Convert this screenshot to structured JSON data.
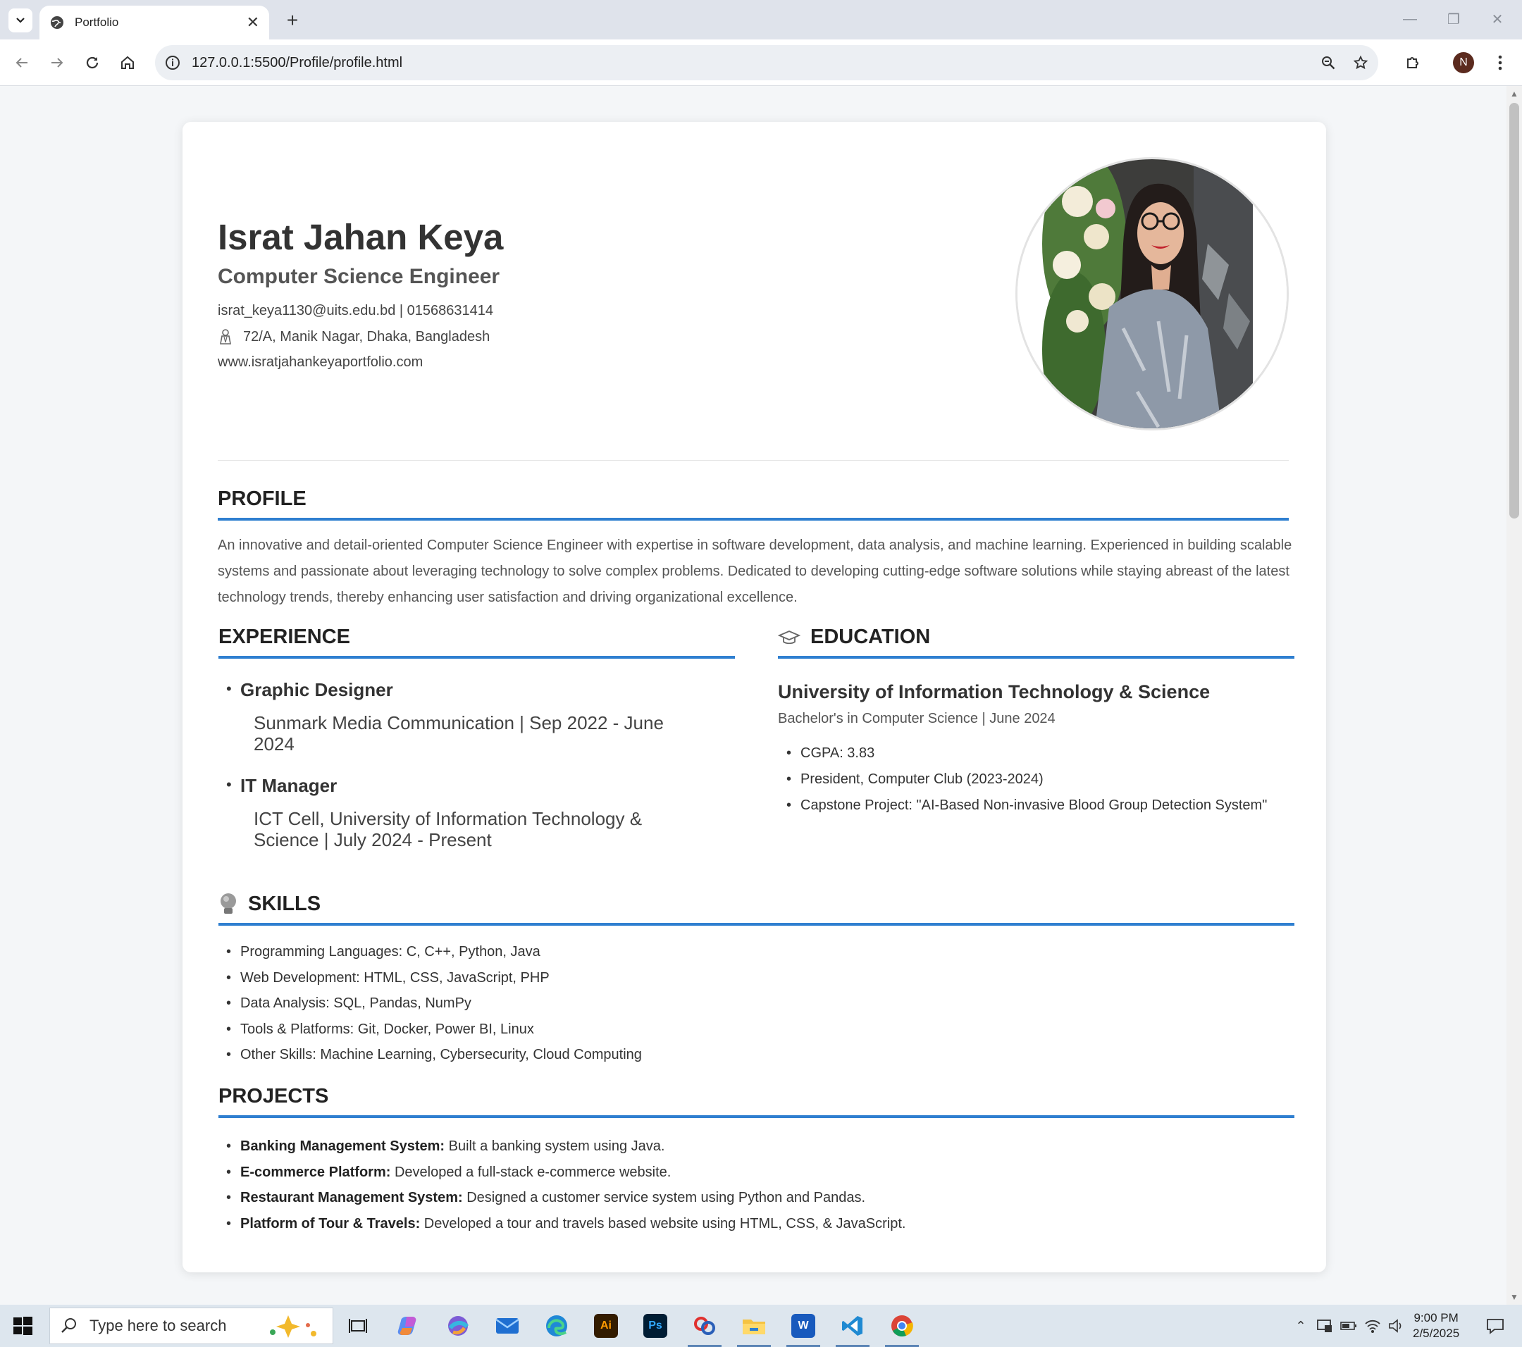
{
  "browser": {
    "tab_title": "Portfolio",
    "url": "127.0.0.1:5500/Profile/profile.html",
    "profile_initial": "N"
  },
  "header": {
    "name": "Israt Jahan Keya",
    "title": "Computer Science Engineer",
    "contact": "israt_keya1130@uits.edu.bd | 01568631414",
    "address": "72/A, Manik Nagar, Dhaka, Bangladesh",
    "website": "www.isratjahankeyaportfolio.com"
  },
  "profile": {
    "heading": "PROFILE",
    "text": "An innovative and detail-oriented Computer Science Engineer with expertise in software development, data analysis, and machine learning. Experienced in building scalable systems and passionate about leveraging technology to solve complex problems. Dedicated to developing cutting-edge software solutions while staying abreast of the latest technology trends, thereby enhancing user satisfaction and driving organizational excellence."
  },
  "experience": {
    "heading": "EXPERIENCE",
    "items": [
      {
        "role": "Graphic Designer",
        "org": "Sunmark Media Communication | Sep 2022 - June 2024"
      },
      {
        "role": "IT Manager",
        "org": "ICT Cell, University of Information Technology & Science | July 2024 - Present"
      }
    ]
  },
  "education": {
    "heading": "EDUCATION",
    "school": "University of Information Technology & Science",
    "degree": "Bachelor's in Computer Science | June 2024",
    "items": [
      "CGPA: 3.83",
      "President, Computer Club (2023-2024)",
      "Capstone Project: \"AI-Based Non-invasive Blood Group Detection System\""
    ]
  },
  "skills": {
    "heading": "SKILLS",
    "items": [
      "Programming Languages: C, C++, Python, Java",
      "Web Development: HTML, CSS, JavaScript, PHP",
      "Data Analysis: SQL, Pandas, NumPy",
      "Tools & Platforms: Git, Docker, Power BI, Linux",
      "Other Skills: Machine Learning, Cybersecurity, Cloud Computing"
    ]
  },
  "projects": {
    "heading": "PROJECTS",
    "items": [
      {
        "name": "Banking Management System:",
        "desc": " Built a banking system using Java."
      },
      {
        "name": "E-commerce Platform:",
        "desc": " Developed a full-stack e-commerce website."
      },
      {
        "name": "Restaurant Management System:",
        "desc": " Designed a customer service system using Python and Pandas."
      },
      {
        "name": "Platform of Tour & Travels:",
        "desc": " Developed a tour and travels based website using HTML, CSS, & JavaScript."
      }
    ]
  },
  "taskbar": {
    "search_placeholder": "Type here to search",
    "time": "9:00 PM",
    "date": "2/5/2025",
    "apps": [
      "task-view",
      "copilot",
      "m365",
      "mail",
      "edge",
      "illustrator",
      "photoshop",
      "app",
      "file-explorer",
      "word",
      "vscode",
      "chrome"
    ]
  },
  "colors": {
    "accent": "#2f7fd0",
    "page_bg": "#f4f6f8",
    "card_bg": "#ffffff",
    "taskbar_bg": "#dde6ee"
  }
}
